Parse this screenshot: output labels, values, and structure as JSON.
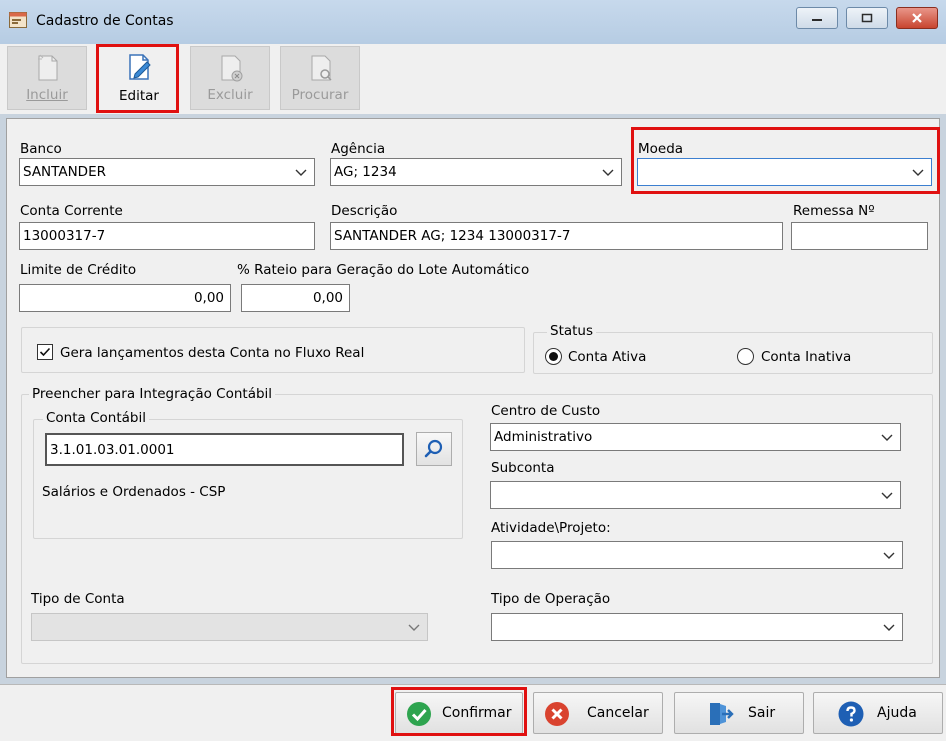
{
  "window": {
    "title": "Cadastro de Contas"
  },
  "toolbar": {
    "incluir": "Incluir",
    "editar": "Editar",
    "excluir": "Excluir",
    "procurar": "Procurar"
  },
  "form": {
    "banco": {
      "label": "Banco",
      "value": "SANTANDER"
    },
    "agencia": {
      "label": "Agência",
      "value": "AG; 1234"
    },
    "moeda": {
      "label": "Moeda",
      "value": ""
    },
    "conta_corrente": {
      "label": "Conta Corrente",
      "value": "13000317-7"
    },
    "descricao": {
      "label": "Descrição",
      "value": "SANTANDER AG; 1234 13000317-7"
    },
    "remessa": {
      "label": "Remessa Nº",
      "value": ""
    },
    "limite": {
      "label": "Limite de Crédito",
      "value": "0,00"
    },
    "rateio": {
      "label": "% Rateio para Geração do Lote Automático",
      "value": "0,00"
    },
    "fluxo_real": {
      "label": "Gera lançamentos desta Conta no Fluxo Real",
      "checked": true
    },
    "status": {
      "title": "Status",
      "ativa": "Conta Ativa",
      "inativa": "Conta Inativa",
      "selected": "ativa"
    },
    "integracao": {
      "title": "Preencher para Integração Contábil",
      "conta_contabil": {
        "title": "Conta Contábil",
        "value": "3.1.01.03.01.0001",
        "description": "Salários e Ordenados - CSP"
      },
      "centro_custo": {
        "label": "Centro de Custo",
        "value": "Administrativo"
      },
      "subconta": {
        "label": "Subconta",
        "value": ""
      },
      "atividade": {
        "label": "Atividade\\Projeto:",
        "value": ""
      }
    },
    "tipo_conta": {
      "label": "Tipo de Conta",
      "value": ""
    },
    "tipo_operacao": {
      "label": "Tipo de Operação",
      "value": ""
    }
  },
  "footer": {
    "confirmar": "Confirmar",
    "cancelar": "Cancelar",
    "sair": "Sair",
    "ajuda": "Ajuda"
  },
  "colors": {
    "highlight": "#e01010",
    "confirm_icon": "#2ea44f",
    "cancel_icon": "#d9432f",
    "help_icon": "#1e5fb4",
    "exit_icon": "#2a6fb8"
  }
}
